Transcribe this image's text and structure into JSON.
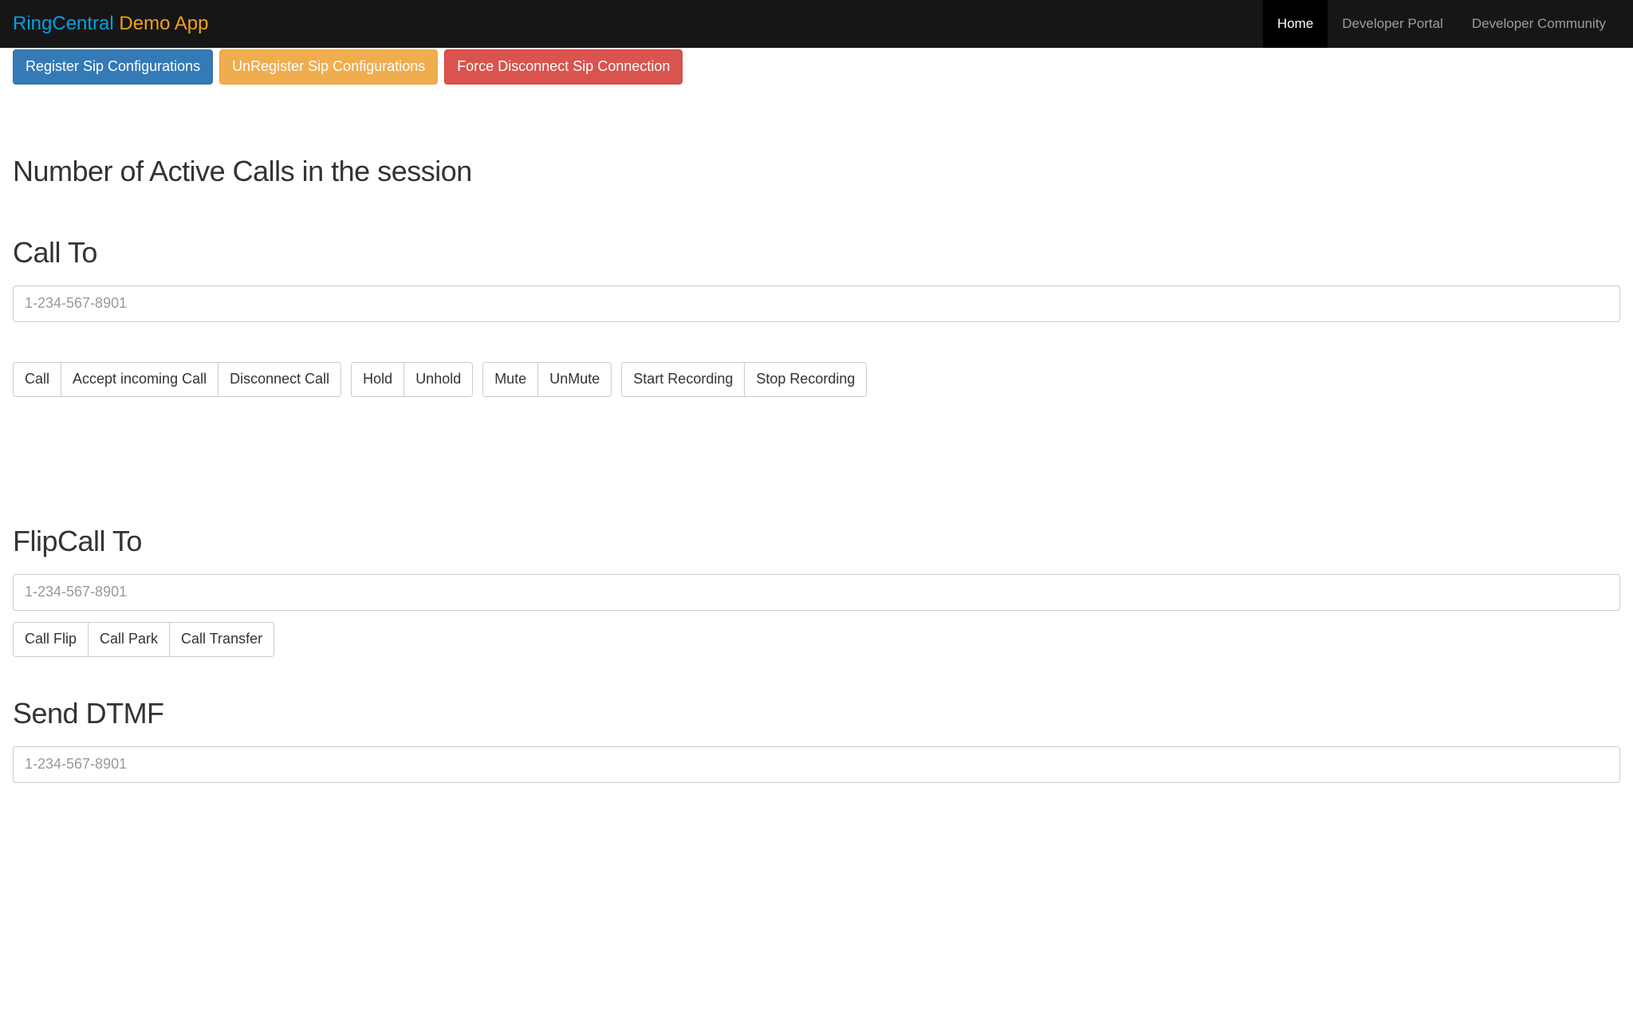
{
  "brand": {
    "part1": "RingCentral",
    "part2": "Demo App"
  },
  "nav": {
    "home": "Home",
    "portal": "Developer Portal",
    "community": "Developer Community"
  },
  "topButtons": {
    "register": "Register Sip Configurations",
    "unregister": "UnRegister Sip Configurations",
    "disconnect": "Force Disconnect Sip Connection"
  },
  "headings": {
    "activeCalls": "Number of Active Calls in the session",
    "callTo": "Call To",
    "flipCallTo": "FlipCall To",
    "sendDtmf": "Send DTMF"
  },
  "placeholders": {
    "phone": "1-234-567-8901"
  },
  "callButtons": {
    "group1": {
      "call": "Call",
      "accept": "Accept incoming Call",
      "disconnect": "Disconnect Call"
    },
    "group2": {
      "hold": "Hold",
      "unhold": "Unhold"
    },
    "group3": {
      "mute": "Mute",
      "unmute": "UnMute"
    },
    "group4": {
      "startRec": "Start Recording",
      "stopRec": "Stop Recording"
    }
  },
  "flipButtons": {
    "flip": "Call Flip",
    "park": "Call Park",
    "transfer": "Call Transfer"
  }
}
